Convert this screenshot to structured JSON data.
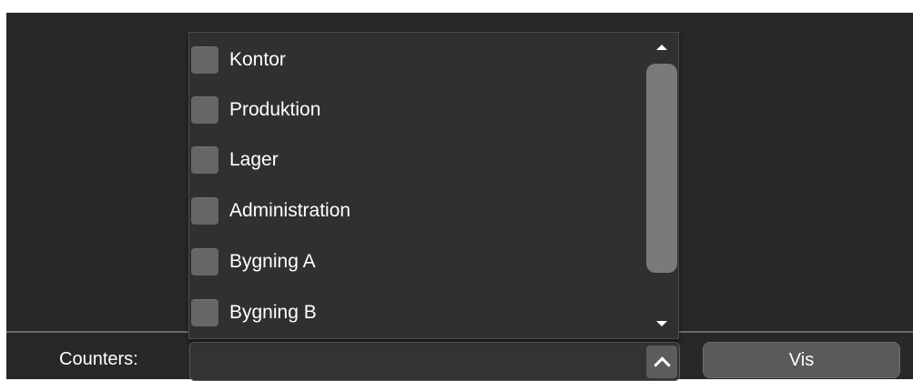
{
  "dropdown": {
    "options": [
      {
        "label": "Kontor",
        "checked": false
      },
      {
        "label": "Produktion",
        "checked": false
      },
      {
        "label": "Lager",
        "checked": false
      },
      {
        "label": "Administration",
        "checked": false
      },
      {
        "label": "Bygning A",
        "checked": false
      },
      {
        "label": "Bygning B",
        "checked": false
      }
    ],
    "icons": {
      "scroll_up": "triangle-up-icon",
      "scroll_down": "triangle-down-icon"
    }
  },
  "bottom_bar": {
    "counters_label": "Counters:",
    "select_value": "",
    "toggle_icon": "chevron-up-icon",
    "vis_button_label": "Vis"
  },
  "colors": {
    "background": "#282828",
    "panel": "#303030",
    "checkbox": "#666666",
    "button": "#5a5a5a",
    "text": "#ffffff"
  }
}
